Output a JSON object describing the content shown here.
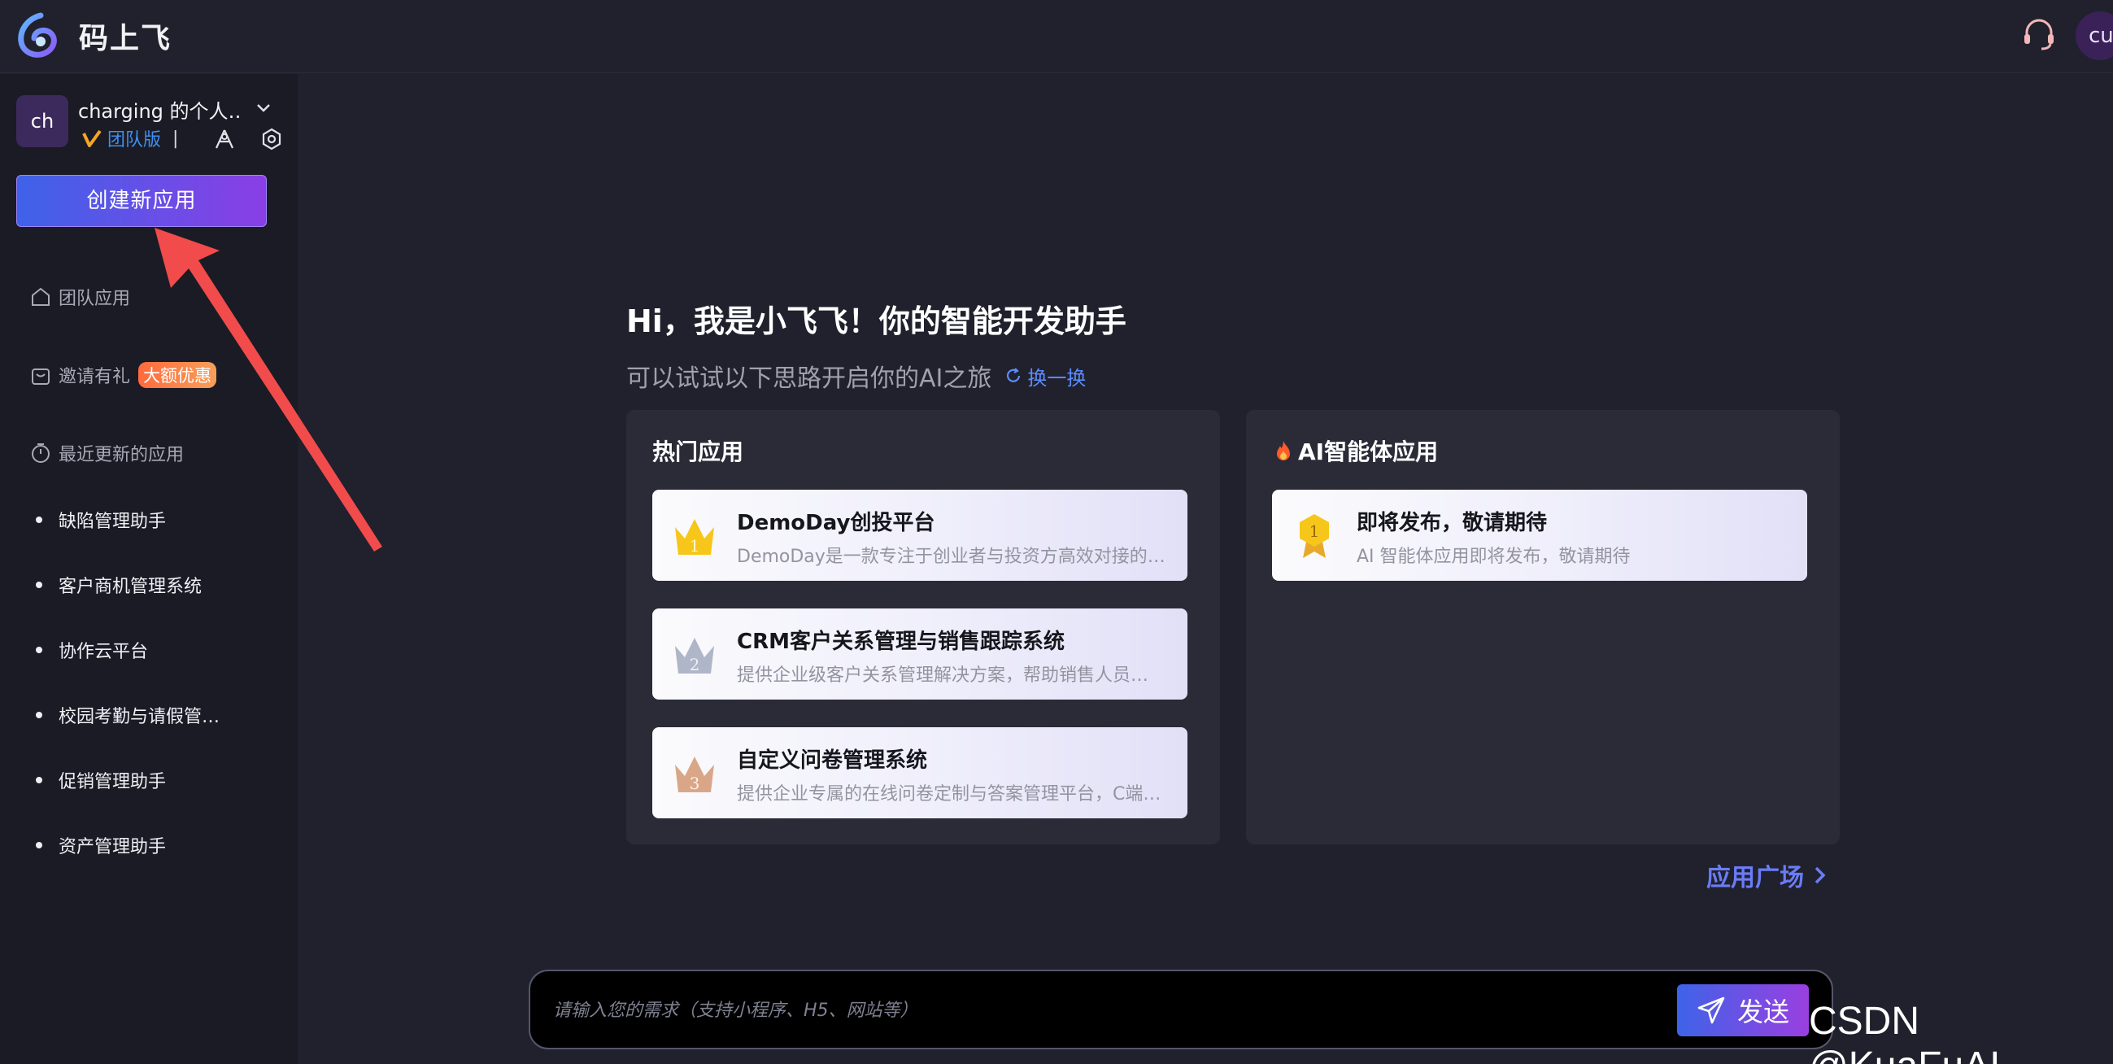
{
  "topbar": {
    "app_title": "码上飞",
    "logo_icon": "app-logo-icon",
    "support_icon": "headset-icon",
    "avatar_text": "cu"
  },
  "sidebar": {
    "team": {
      "avatar_text": "ch",
      "name": "charging 的个人…",
      "plan_label": "团队版",
      "plan_separator": "|"
    },
    "create_button": "创建新应用",
    "nav": {
      "team_apps": "团队应用",
      "invite": "邀请有礼",
      "invite_badge": "大额优惠",
      "recent_header": "最近更新的应用"
    },
    "recent_apps": [
      "缺陷管理助手",
      "客户商机管理系统",
      "协作云平台",
      "校园考勤与请假管…",
      "促销管理助手",
      "资产管理助手"
    ]
  },
  "main": {
    "hero_title": "Hi，我是小飞飞！你的智能开发助手",
    "hero_subtitle": "可以试试以下思路开启你的AI之旅",
    "refresh_label": "换一换",
    "hot_panel": {
      "title": "热门应用",
      "cards": [
        {
          "rank": "1",
          "title": "DemoDay创投平台",
          "desc": "DemoDay是一款专注于创业者与投资方高效对接的…"
        },
        {
          "rank": "2",
          "title": "CRM客户关系管理与销售跟踪系统",
          "desc": "提供企业级客户关系管理解决方案，帮助销售人员…"
        },
        {
          "rank": "3",
          "title": "自定义问卷管理系统",
          "desc": "提供企业专属的在线问卷定制与答案管理平台，C端…"
        }
      ]
    },
    "ai_panel": {
      "title": "AI智能体应用",
      "cards": [
        {
          "rank": "1",
          "title": "即将发布，敬请期待",
          "desc": "AI 智能体应用即将发布，敬请期待"
        }
      ]
    },
    "market_link": "应用广场"
  },
  "input": {
    "placeholder": "请输入您的需求（支持小程序、H5、网站等）",
    "value": "",
    "send_label": "发送"
  },
  "watermark": "CSDN @KuaFuAI",
  "colors": {
    "accent_start": "#3e63e8",
    "accent_end": "#8a3ee6",
    "link": "#5b8cff",
    "annotation": "#f24b4b"
  }
}
